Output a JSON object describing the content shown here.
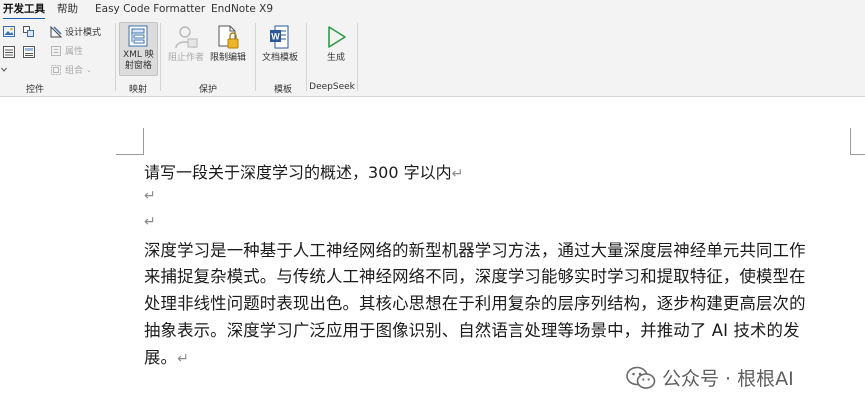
{
  "tabs": [
    {
      "label": "开发工具",
      "active": true
    },
    {
      "label": "帮助",
      "active": false
    },
    {
      "label": "Easy Code Formatter",
      "active": false
    },
    {
      "label": "EndNote X9",
      "active": false
    }
  ],
  "ribbon": {
    "controls_group": {
      "label": "控件",
      "design_mode": "设计模式",
      "properties": "属性",
      "group": "组合"
    },
    "mapping_group": {
      "label": "映射",
      "xml_line1": "XML 映",
      "xml_line2": "射窗格"
    },
    "protect_group": {
      "label": "保护",
      "block_authors": "阻止作者",
      "restrict_editing": "限制编辑"
    },
    "template_group": {
      "label": "模板",
      "doc_template": "文档模板"
    },
    "deepseek_group": {
      "label": "DeepSeek",
      "generate": "生成"
    }
  },
  "document": {
    "prompt": "请写一段关于深度学习的概述，300 字以内",
    "paragraph_mark": "↵",
    "body_lines": [
      "深度学习是一种基于人工神经网络的新型机器学习方法，通过大量深度层神经单元共同工作",
      "来捕捉复杂模式。与传统人工神经网络不同，深度学习能够实时学习和提取特征，使模型在",
      "处理非线性问题时表现出色。其核心思想在于利用复杂的层序列结构，逐步构建更高层次的",
      "抽象表示。深度学习广泛应用于图像识别、自然语言处理等场景中，并推动了 AI 技术的发",
      "展。"
    ]
  },
  "watermark": {
    "text": "公众号 · 根根AI"
  },
  "colors": {
    "accent": "#1a5fb4",
    "ribbon_bg": "#f3f3f3",
    "generate_green": "#2e9a4a",
    "word_blue": "#2b579a"
  }
}
